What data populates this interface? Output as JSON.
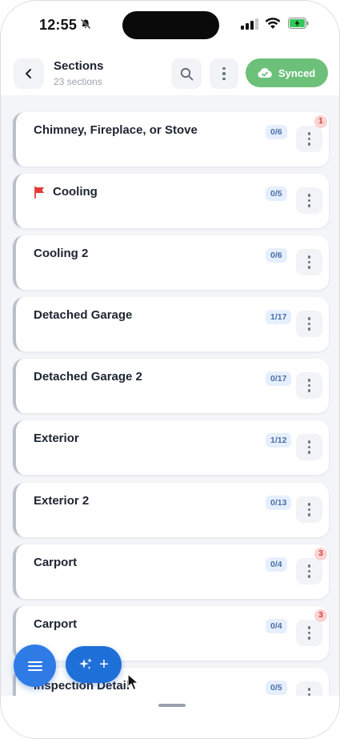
{
  "status_bar": {
    "time": "12:55",
    "icons": [
      "bell-muted-icon",
      "cellular-signal-icon",
      "wifi-icon",
      "battery-charging-icon"
    ]
  },
  "header": {
    "title": "Sections",
    "subtitle": "23 sections",
    "back_icon": "chevron-left-icon",
    "search_icon": "search-icon",
    "more_icon": "more-vertical-icon",
    "sync_label": "Synced",
    "sync_icon": "cloud-check-icon"
  },
  "sections": [
    {
      "label": "Chimney, Fireplace, or Stove",
      "count": "0/6",
      "alerts": "1",
      "flagged": false
    },
    {
      "label": "Cooling",
      "count": "0/5",
      "alerts": "",
      "flagged": true
    },
    {
      "label": "Cooling 2",
      "count": "0/6",
      "alerts": "",
      "flagged": false
    },
    {
      "label": "Detached Garage",
      "count": "1/17",
      "alerts": "",
      "flagged": false
    },
    {
      "label": "Detached Garage 2",
      "count": "0/17",
      "alerts": "",
      "flagged": false
    },
    {
      "label": "Exterior",
      "count": "1/12",
      "alerts": "",
      "flagged": false
    },
    {
      "label": "Exterior 2",
      "count": "0/13",
      "alerts": "",
      "flagged": false
    },
    {
      "label": "Carport",
      "count": "0/4",
      "alerts": "3",
      "flagged": false
    },
    {
      "label": "Carport",
      "count": "0/4",
      "alerts": "3",
      "flagged": false
    },
    {
      "label": "Inspection Detail",
      "count": "0/5",
      "alerts": "",
      "flagged": false
    }
  ],
  "fab": {
    "menu_icon": "hamburger-menu-icon",
    "add_icon": "sparkle-icon",
    "add_label": "+"
  },
  "colors": {
    "accent": "#2f7be6",
    "synced": "#6cc07a",
    "alert": "#d43b3b",
    "flag": "#e53935"
  }
}
